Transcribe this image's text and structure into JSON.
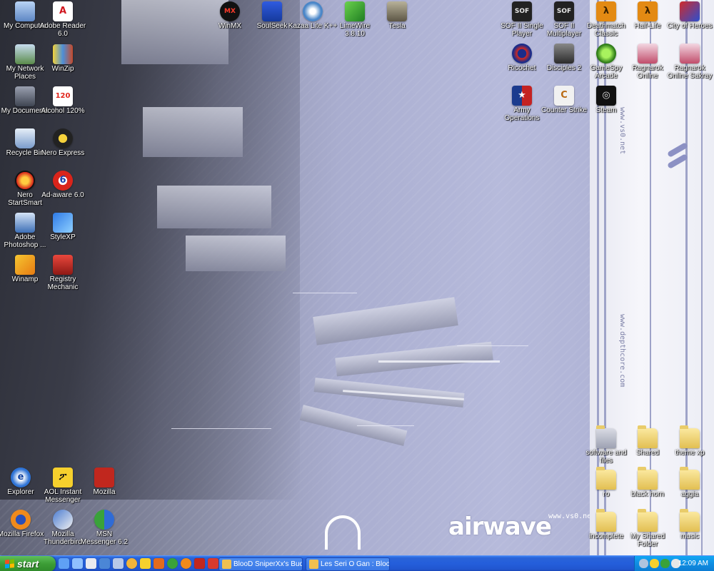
{
  "desktop": {
    "wallpaper_logo": "airwave",
    "wallpaper_site": "www.vs0.net",
    "wallpaper_vertical_1": "www.vs0.net",
    "wallpaper_vertical_2": "www.depthcore.com",
    "icons": {
      "my_computer": "My Computer",
      "adobe_reader": "Adobe Reader 6.0",
      "my_network_places": "My Network Places",
      "winzip": "WinZip",
      "my_documents": "My Documents",
      "alcohol": "Alcohol 120%",
      "recycle_bin": "Recycle Bin",
      "nero_express": "Nero Express",
      "nero_startsmart": "Nero StartSmart",
      "adaware": "Ad-aware 6.0",
      "photoshop": "Adobe Photoshop ...",
      "stylexp": "StyleXP",
      "winamp": "Winamp",
      "registry_mechanic": "Registry Mechanic",
      "winmx": "WinMX",
      "soulseek": "SoulSeek",
      "kazaa": "Kazaa Lite K++",
      "limewire": "LimeWire 3.8.10",
      "tesla": "Tesla",
      "sof2_single": "SOF II Single Player",
      "sof2_multi": "SOF II Multiplayer",
      "deathmatch_classic": "Deathmatch Classic",
      "half_life": "Half-Life",
      "city_of_heroes": "City of Heroes",
      "ricochet": "Ricochet",
      "disciples2": "Disciples 2",
      "gamespy": "GameSpy Arcade",
      "ragnarok_online": "Ragnarok Online",
      "ragnarok_sakray": "Ragnarok Online Sakray",
      "army_operations": "Army Operations",
      "counter_strike": "Counter Strike",
      "steam": "Steam",
      "software_files": "software and files",
      "shared": "Shared",
      "theme_xp": "theme xp",
      "ro": "ro",
      "blackhorn": "black horn",
      "aggia": "aggia",
      "incomplete": "incomplete",
      "my_shared_folder": "My Shared Folder",
      "music": "music",
      "explorer": "Explorer",
      "aim": "AOL Instant Messenger",
      "mozilla": "Mozilla",
      "firefox": "Mozilla Firefox",
      "thunderbird": "Mozilla Thunderbird",
      "msn": "MSN Messenger 6.2"
    }
  },
  "taskbar": {
    "start_label": "start",
    "tasks": [
      {
        "label": "BlooD SniperXx's Bud..."
      },
      {
        "label": "Les Seri O Gan : Bloo..."
      }
    ],
    "clock": "12:09 AM"
  },
  "colors": {
    "taskbar_blue": "#245edb",
    "start_green": "#3c9d36",
    "tray_blue": "#0f8de2"
  }
}
